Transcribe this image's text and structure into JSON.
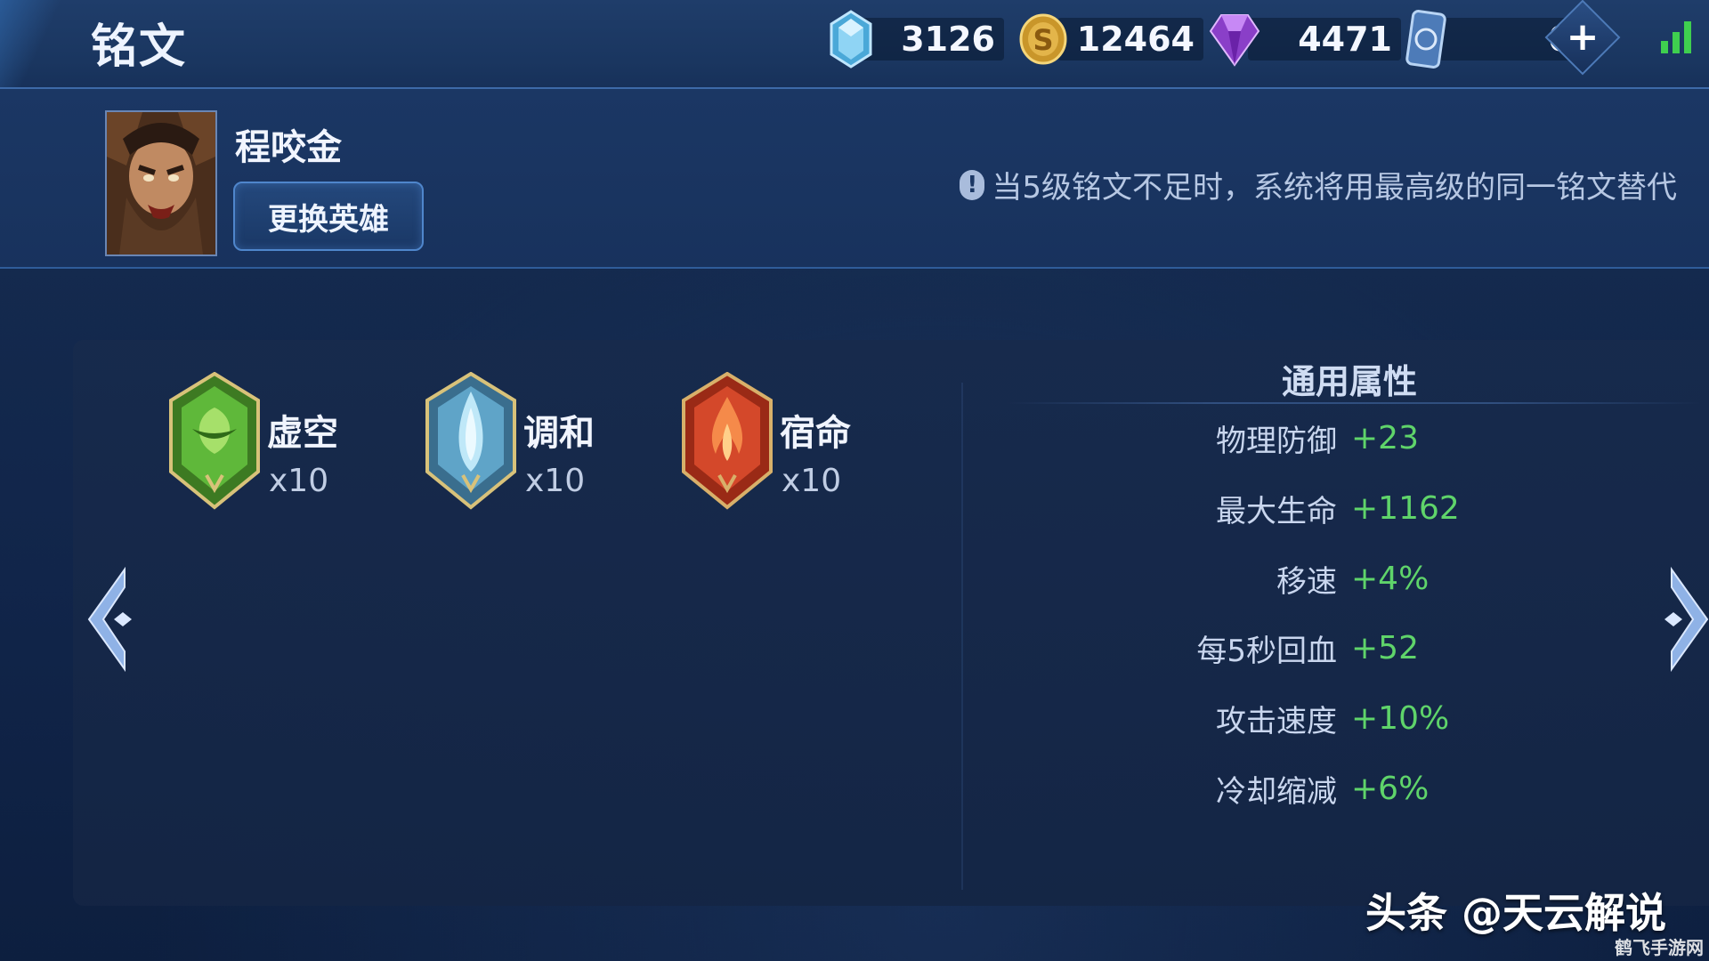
{
  "header": {
    "title": "铭文",
    "currencies": [
      {
        "icon": "ice-crystal-icon",
        "value": "3126"
      },
      {
        "icon": "gold-coin-icon",
        "value": "12464"
      },
      {
        "icon": "purple-gem-icon",
        "value": "4471"
      },
      {
        "icon": "ticket-card-icon",
        "value": "0"
      }
    ],
    "add_label": "+"
  },
  "hero": {
    "name": "程咬金",
    "change_button": "更换英雄",
    "notice_icon": "!",
    "notice": "当5级铭文不足时，系统将用最高级的同一铭文替代"
  },
  "runes": [
    {
      "name": "虚空",
      "count": "x10",
      "color": "#5fb83a"
    },
    {
      "name": "调和",
      "count": "x10",
      "color": "#7fc4e6"
    },
    {
      "name": "宿命",
      "count": "x10",
      "color": "#d4482a"
    }
  ],
  "stats": {
    "title": "通用属性",
    "rows": [
      {
        "label": "物理防御",
        "value": "+23"
      },
      {
        "label": "最大生命",
        "value": "+1162"
      },
      {
        "label": "移速",
        "value": "+4%"
      },
      {
        "label": "每5秒回血",
        "value": "+52"
      },
      {
        "label": "攻击速度",
        "value": "+10%"
      },
      {
        "label": "冷却缩减",
        "value": "+6%"
      }
    ]
  },
  "watermark": {
    "main": "头条 @天云解说",
    "small": "鹤飞手游网"
  },
  "colors": {
    "stat_value": "#5fd46a",
    "panel_bg": "#172a4c",
    "button_border": "#4f86cc"
  }
}
